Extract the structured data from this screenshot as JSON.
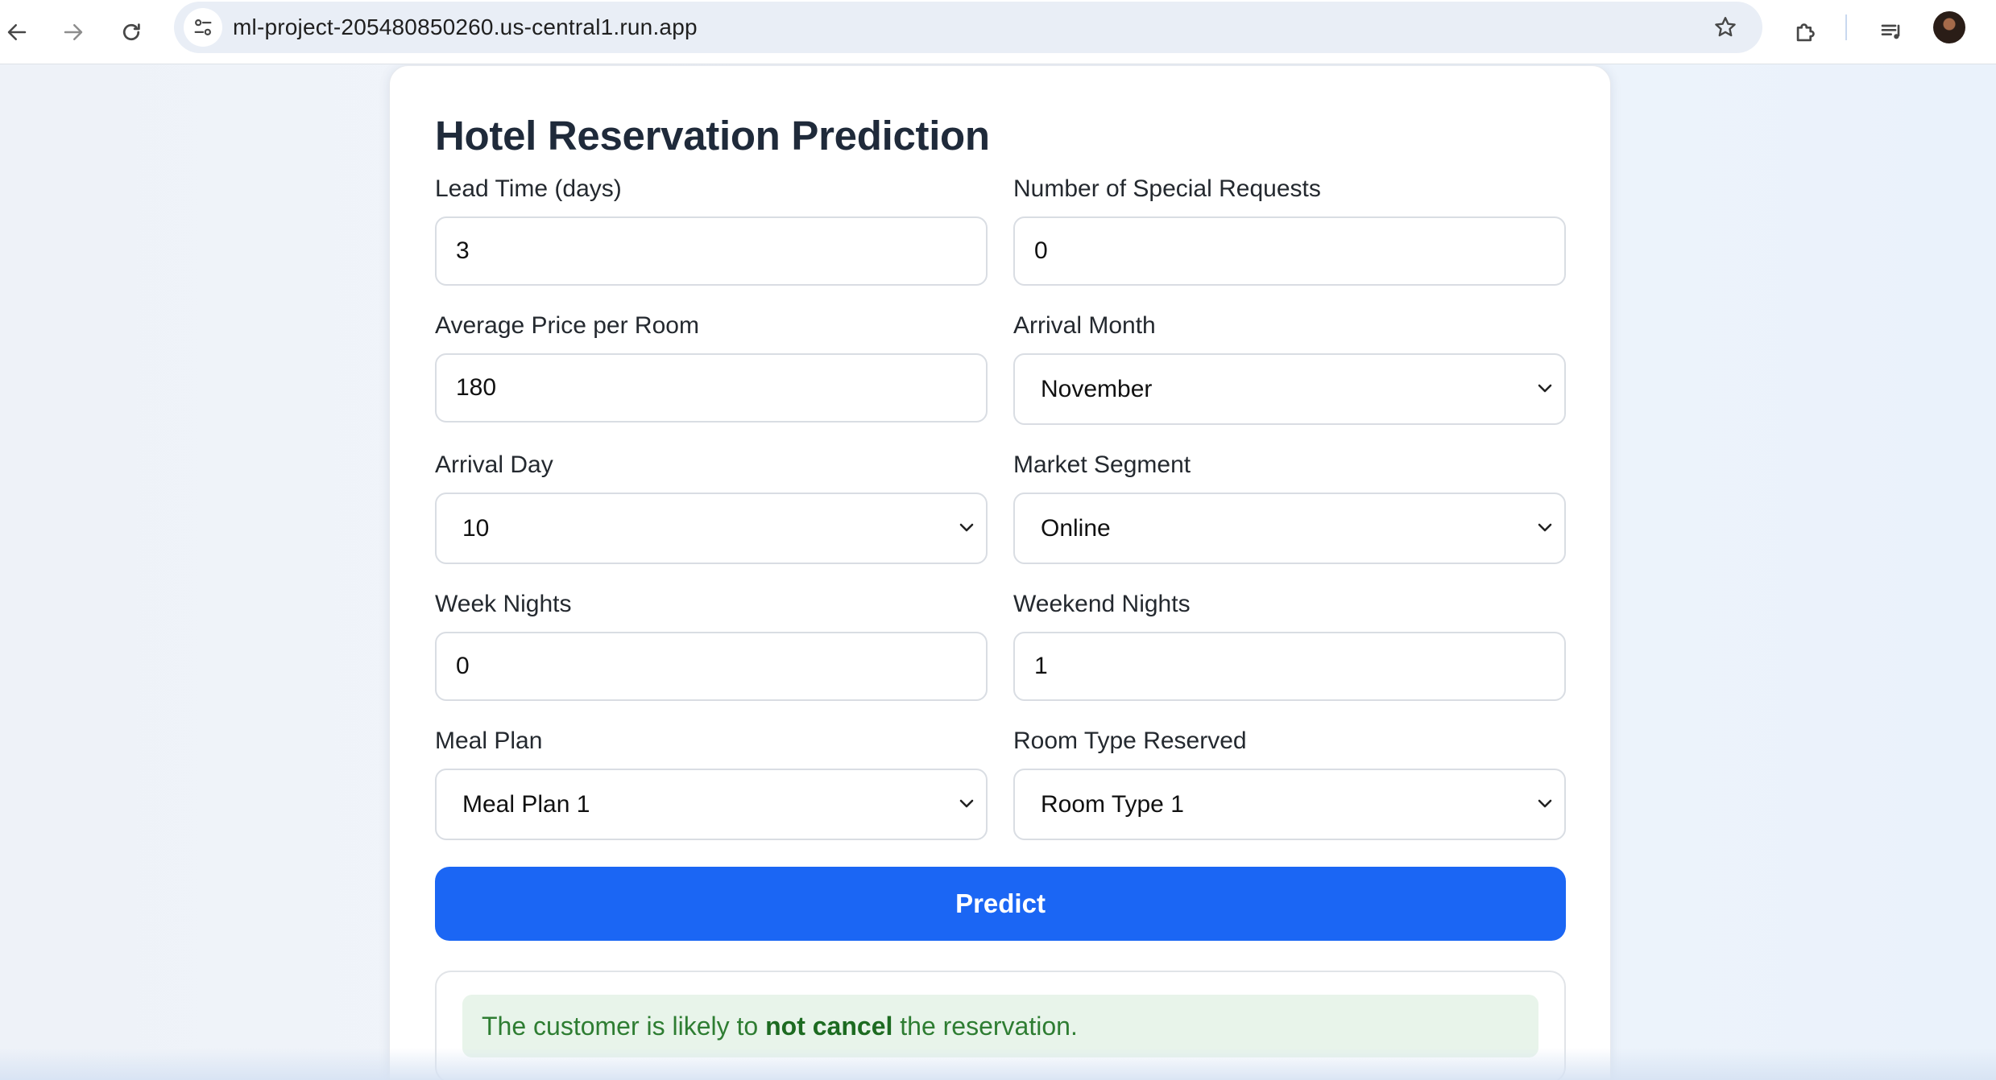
{
  "browser": {
    "url": "ml-project-205480850260.us-central1.run.app",
    "icons": {
      "back": "back-arrow-icon",
      "forward": "forward-arrow-icon",
      "reload": "reload-icon",
      "site_info": "tune-icon",
      "bookmark": "star-icon",
      "extensions": "puzzle-icon",
      "media": "media-queue-icon",
      "profile": "avatar"
    }
  },
  "form": {
    "title": "Hotel Reservation Prediction",
    "fields": {
      "lead_time": {
        "label": "Lead Time (days)",
        "value": "3"
      },
      "special_requests": {
        "label": "Number of Special Requests",
        "value": "0"
      },
      "avg_price": {
        "label": "Average Price per Room",
        "value": "180"
      },
      "arrival_month": {
        "label": "Arrival Month",
        "value": "November"
      },
      "arrival_day": {
        "label": "Arrival Day",
        "value": "10"
      },
      "market_segment": {
        "label": "Market Segment",
        "value": "Online"
      },
      "week_nights": {
        "label": "Week Nights",
        "value": "0"
      },
      "weekend_nights": {
        "label": "Weekend Nights",
        "value": "1"
      },
      "meal_plan": {
        "label": "Meal Plan",
        "value": "Meal Plan 1"
      },
      "room_type": {
        "label": "Room Type Reserved",
        "value": "Room Type 1"
      }
    },
    "predict_label": "Predict"
  },
  "result": {
    "prefix": "The customer is likely to ",
    "emphasis": "not cancel",
    "suffix": " the reservation."
  },
  "colors": {
    "accent": "#1b66f4",
    "success_text": "#2e7d32",
    "success_bg": "#e8f4ea"
  }
}
